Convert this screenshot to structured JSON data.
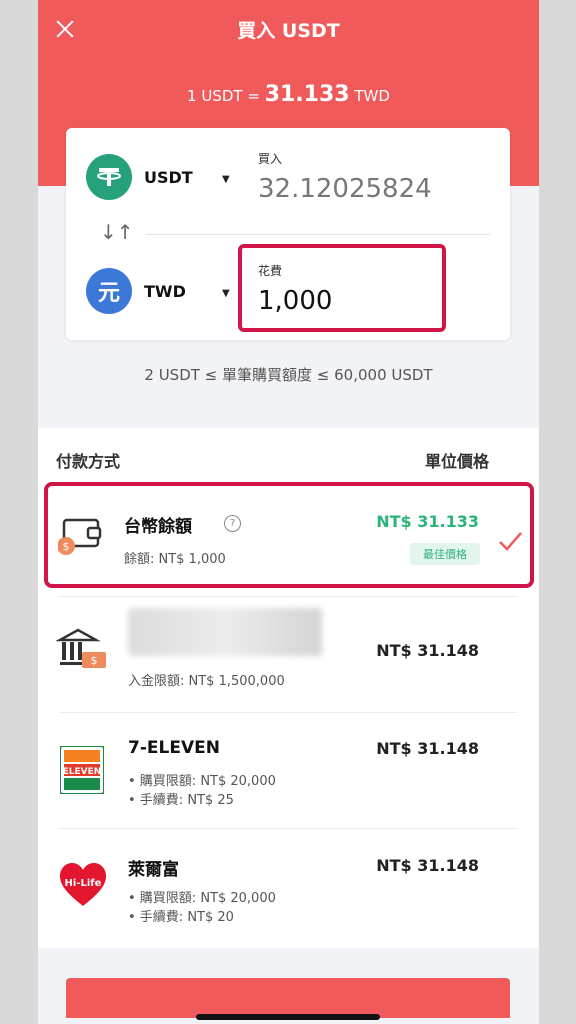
{
  "header": {
    "title": "買入 USDT",
    "rate_prefix": "1 USDT =",
    "rate_value": "31.133",
    "rate_suffix": "TWD"
  },
  "converter": {
    "from_currency": "USDT",
    "from_label": "買入",
    "from_amount": "32.12025824",
    "to_currency": "TWD",
    "to_symbol": "元",
    "to_label": "花費",
    "to_amount": "1,000"
  },
  "limits_text": "2 USDT ≤ 單筆購買額度 ≤ 60,000 USDT",
  "methods_header": {
    "left": "付款方式",
    "right": "單位價格"
  },
  "methods": [
    {
      "name": "台幣餘額",
      "sub": "餘額: NT$ 1,000",
      "price": "NT$ 31.133",
      "badge": "最佳價格",
      "selected": true
    },
    {
      "name": "",
      "sub": "入金限額: NT$ 1,500,000",
      "price": "NT$ 31.148"
    },
    {
      "name": "7-ELEVEN",
      "sub1": "• 購買限額: NT$ 20,000",
      "sub2": "• 手續費: NT$ 25",
      "price": "NT$ 31.148"
    },
    {
      "name": "萊爾富",
      "sub1": "• 購買限額: NT$ 20,000",
      "sub2": "• 手續費: NT$ 20",
      "price": "NT$ 31.148"
    }
  ],
  "icons": [
    "close-icon",
    "usdt-coin-icon",
    "twd-coin-icon",
    "swap-arrows-icon",
    "wallet-icon",
    "help-icon",
    "checkmark-icon",
    "bank-icon",
    "seven-eleven-logo",
    "hilife-logo"
  ],
  "colors": {
    "header": "#f05a5a",
    "highlight": "#d11549",
    "best_price": "#2bb47a",
    "usdt": "#26a17b",
    "twd": "#3b78d8"
  }
}
